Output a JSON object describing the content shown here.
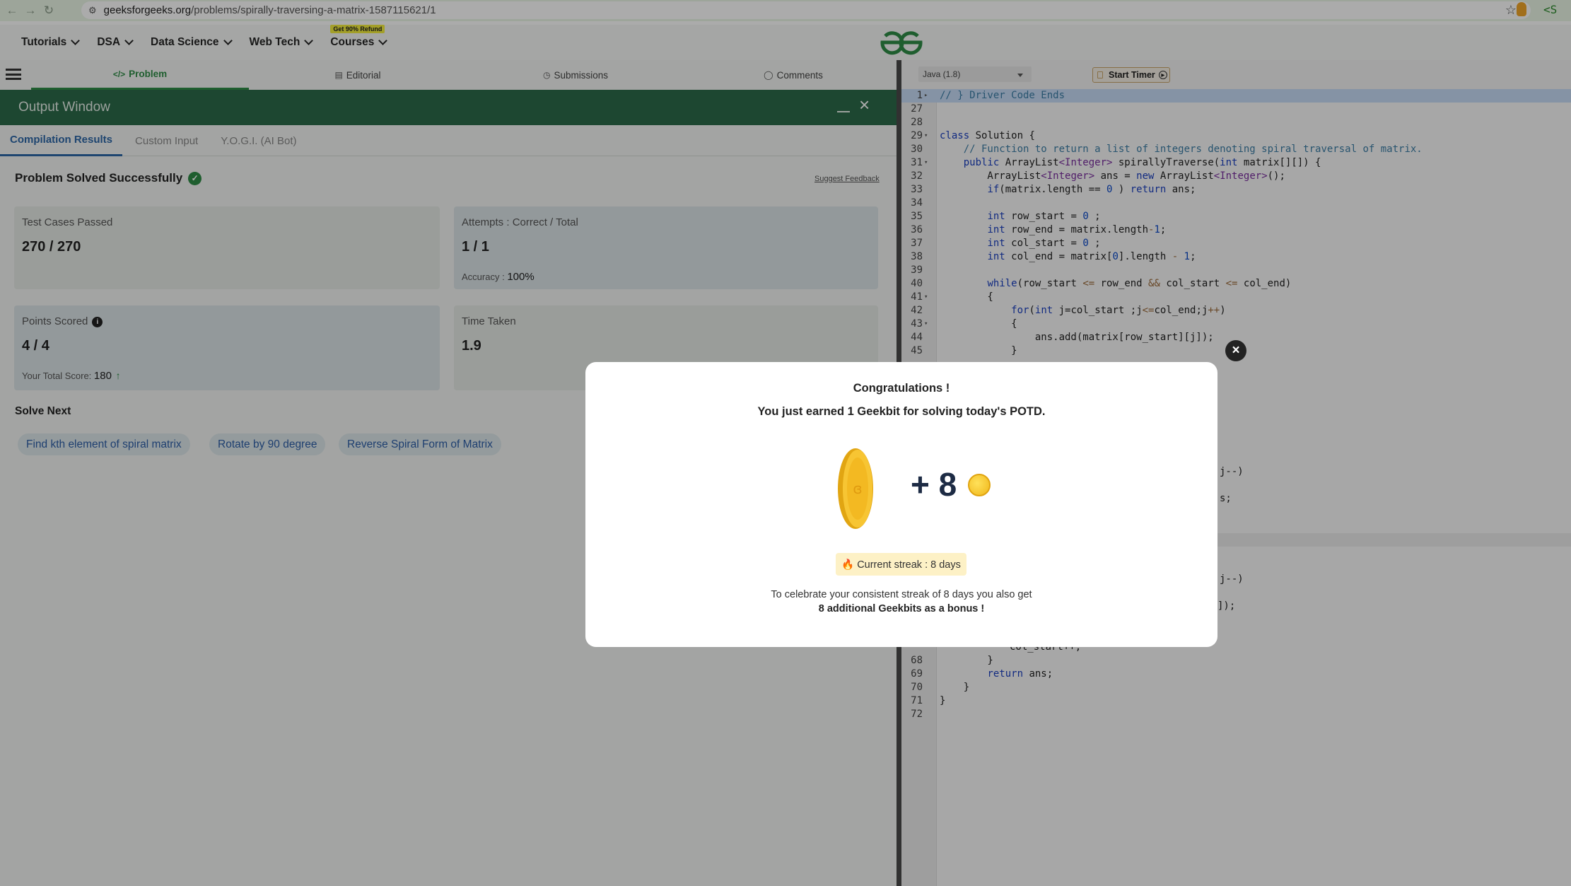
{
  "browser": {
    "url_host": "geeksforgeeks.org",
    "url_path": "/problems/spirally-traversing-a-matrix-1587115621/1",
    "ext_label": "<S"
  },
  "nav": {
    "items": [
      "Tutorials",
      "DSA",
      "Data Science",
      "Web Tech",
      "Courses"
    ],
    "courses_badge": "Get 90% Refund"
  },
  "tabs": [
    "Problem",
    "Editorial",
    "Submissions",
    "Comments"
  ],
  "output": {
    "title": "Output Window",
    "subtabs": [
      "Compilation Results",
      "Custom Input",
      "Y.O.G.I. (AI Bot)"
    ],
    "status": "Problem Solved Successfully",
    "feedback": "Suggest Feedback",
    "cards": {
      "tests_label": "Test Cases Passed",
      "tests_value": "270 / 270",
      "attempts_label": "Attempts : Correct / Total",
      "attempts_value": "1 / 1",
      "accuracy_label": "Accuracy :",
      "accuracy_value": "100%",
      "points_label": "Points Scored",
      "points_value": "4 / 4",
      "total_label": "Your Total Score:",
      "total_value": "180",
      "time_label": "Time Taken",
      "time_value": "1.9"
    },
    "solve_next_title": "Solve Next",
    "solve_next": [
      "Find kth element of spiral matrix",
      "Rotate by 90 degree",
      "Reverse Spiral Form of Matrix"
    ]
  },
  "editor": {
    "language": "Java (1.8)",
    "timer": "Start Timer",
    "lines": [
      {
        "n": "1",
        "fold": "▸",
        "hl": true,
        "html": "<span class=\"cm\">// } Driver Code Ends</span>"
      },
      {
        "n": "27",
        "html": ""
      },
      {
        "n": "28",
        "html": ""
      },
      {
        "n": "29",
        "fold": "▾",
        "html": "<span class=\"kw\">class</span> Solution {"
      },
      {
        "n": "30",
        "html": "    <span class=\"cm\">// Function to return a list of integers denoting spiral traversal of matrix.</span>"
      },
      {
        "n": "31",
        "fold": "▾",
        "html": "    <span class=\"kw\">public</span> ArrayList<span class=\"ty\">&lt;Integer&gt;</span> spirallyTraverse(<span class=\"kw\">int</span> matrix[][]) {"
      },
      {
        "n": "32",
        "html": "        ArrayList<span class=\"ty\">&lt;Integer&gt;</span> ans = <span class=\"kw\">new</span> ArrayList<span class=\"ty\">&lt;Integer&gt;</span>();"
      },
      {
        "n": "33",
        "html": "        <span class=\"kw\">if</span>(matrix.length == <span class=\"nm\">0</span> ) <span class=\"kw\">return</span> ans;"
      },
      {
        "n": "34",
        "html": ""
      },
      {
        "n": "35",
        "html": "        <span class=\"kw\">int</span> row_start = <span class=\"nm\">0</span> ;"
      },
      {
        "n": "36",
        "html": "        <span class=\"kw\">int</span> row_end = matrix.length<span class=\"op\">-</span><span class=\"nm\">1</span>;"
      },
      {
        "n": "37",
        "html": "        <span class=\"kw\">int</span> col_start = <span class=\"nm\">0</span> ;"
      },
      {
        "n": "38",
        "html": "        <span class=\"kw\">int</span> col_end = matrix[<span class=\"nm\">0</span>].length <span class=\"op\">-</span> <span class=\"nm\">1</span>;"
      },
      {
        "n": "39",
        "html": ""
      },
      {
        "n": "40",
        "html": "        <span class=\"kw\">while</span>(row_start <span class=\"op\">&lt;=</span> row_end <span class=\"op\">&amp;&amp;</span> col_start <span class=\"op\">&lt;=</span> col_end)"
      },
      {
        "n": "41",
        "fold": "▾",
        "html": "        {"
      },
      {
        "n": "42",
        "html": "            <span class=\"kw\">for</span>(<span class=\"kw\">int</span> j=col_start ;j<span class=\"op\">&lt;=</span>col_end;j<span class=\"op\">++</span>)"
      },
      {
        "n": "43",
        "fold": "▾",
        "html": "            {"
      },
      {
        "n": "44",
        "html": "                ans.add(matrix[row_start][j]);"
      },
      {
        "n": "45",
        "html": "            }"
      }
    ],
    "lines_bottom": [
      {
        "n": "68",
        "html": "        }"
      },
      {
        "n": "69",
        "html": "        <span class=\"kw\">return</span> ans;"
      },
      {
        "n": "70",
        "html": "    }"
      },
      {
        "n": "71",
        "html": "}"
      },
      {
        "n": "72",
        "html": ""
      }
    ],
    "fragments": [
      "j--)",
      "s;",
      "j--)",
      "]);",
      "col_start++;"
    ]
  },
  "modal": {
    "title": "Congratulations !",
    "subtitle": "You just earned 1 Geekbit for solving today's POTD.",
    "plus_label": "+ 8",
    "streak": "🔥 Current streak : 8 days",
    "body": "To celebrate your consistent streak of 8 days you also get",
    "bonus": "8 additional Geekbits as a bonus !"
  },
  "colors": {
    "brand": "#2f8d46",
    "output_header": "#2c6a49",
    "link": "#2d5ea8"
  }
}
